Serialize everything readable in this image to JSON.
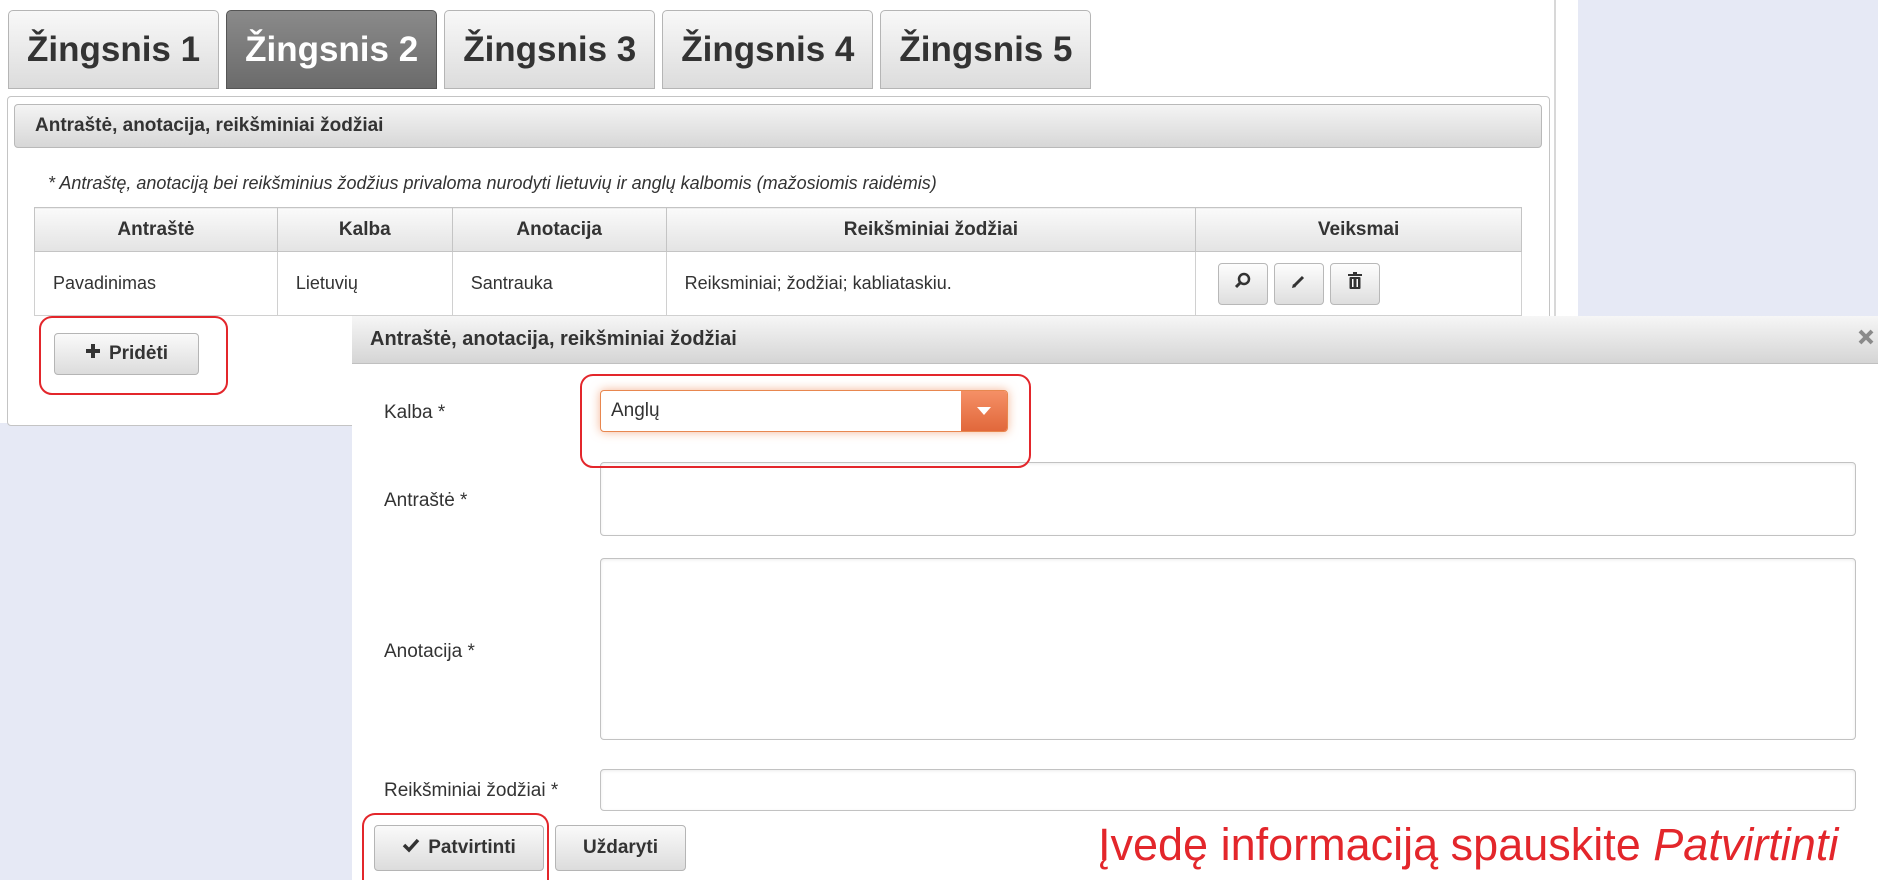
{
  "wizard": {
    "tabs": [
      {
        "label": "Žingsnis 1",
        "active": false
      },
      {
        "label": "Žingsnis 2",
        "active": true
      },
      {
        "label": "Žingsnis 3",
        "active": false
      },
      {
        "label": "Žingsnis 4",
        "active": false
      },
      {
        "label": "Žingsnis 5",
        "active": false
      }
    ]
  },
  "panel": {
    "title": "Antraštė, anotacija, reikšminiai žodžiai",
    "note": "* Antraštę, anotaciją bei reikšminius žodžius privaloma nurodyti lietuvių ir anglų kalbomis (mažosiomis raidėmis)",
    "table": {
      "headers": [
        "Antraštė",
        "Kalba",
        "Anotacija",
        "Reikšminiai žodžiai",
        "Veiksmai"
      ],
      "rows": [
        {
          "title": "Pavadinimas",
          "language": "Lietuvių",
          "abstract": "Santrauka",
          "keywords": "Reiksminiai; žodžiai; kabliataskiu."
        }
      ],
      "actions": [
        "magnifier-icon",
        "pencil-icon",
        "trash-icon"
      ]
    },
    "add_button": {
      "label": "Pridėti",
      "icon": "plus-icon"
    }
  },
  "dialog": {
    "title": "Antraštė, anotacija, reikšminiai žodžiai",
    "close_icon": "close-icon",
    "language_label": "Kalba *",
    "language_value": "Anglų",
    "title_label": "Antraštė *",
    "title_value": "",
    "abstract_label": "Anotacija *",
    "abstract_value": "",
    "keywords_label": "Reikšminiai žodžiai *",
    "keywords_value": "",
    "confirm_button": {
      "label": "Patvirtinti",
      "icon": "checkmark-icon"
    },
    "close_button": {
      "label": "Uždaryti"
    }
  },
  "annotation": {
    "text_before": "Įvedę informaciją spauskite ",
    "text_emphasis": "Patvirtinti"
  },
  "colors": {
    "highlight_ring": "#e3262b",
    "select_accent": "#e1683b",
    "active_tab": "#6b6b6b"
  }
}
